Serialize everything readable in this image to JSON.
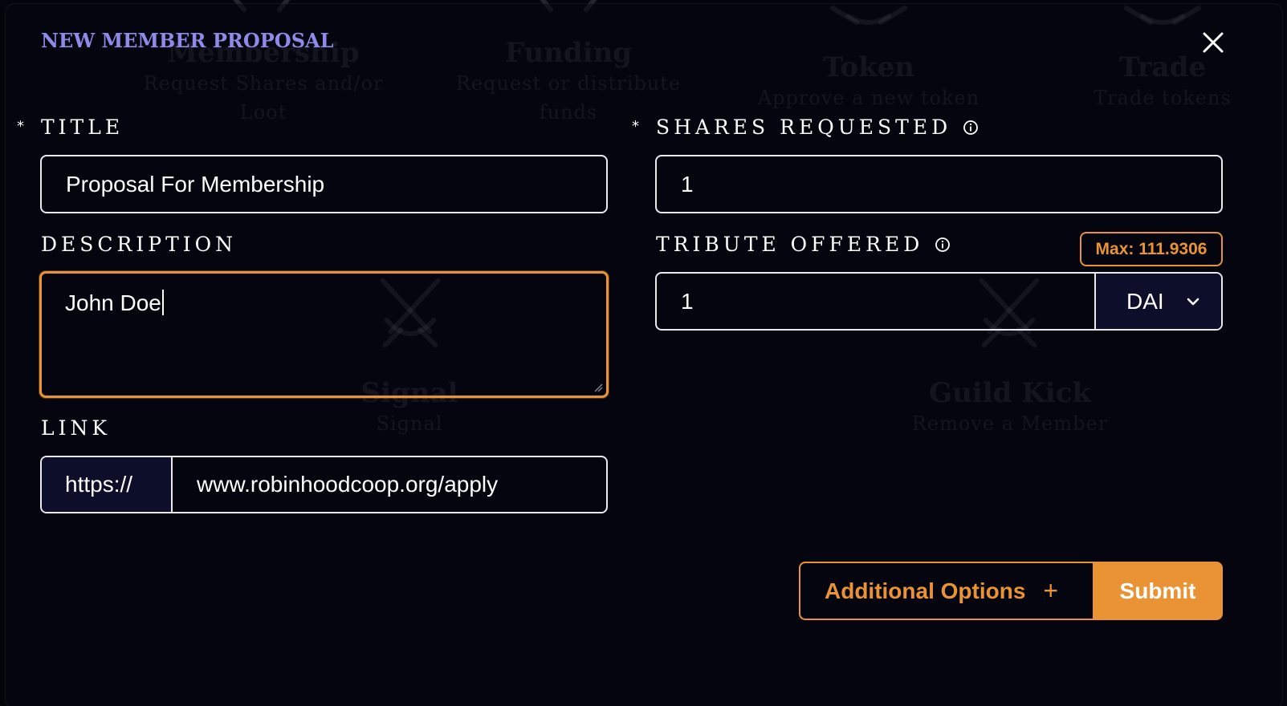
{
  "background": {
    "cards": [
      {
        "title": "Membership",
        "sub1": "Request Shares and/or",
        "sub2": "Loot"
      },
      {
        "title": "Funding",
        "sub1": "Request or distribute",
        "sub2": "funds"
      },
      {
        "title": "Token",
        "sub1": "Approve a new token",
        "sub2": ""
      },
      {
        "title": "Trade",
        "sub1": "Trade tokens",
        "sub2": ""
      },
      {
        "title": "Signal",
        "sub1": "Signal",
        "sub2": ""
      },
      {
        "title": "Guild Kick",
        "sub1": "Remove a Member",
        "sub2": ""
      }
    ]
  },
  "modal": {
    "title": "NEW MEMBER PROPOSAL",
    "close_icon": "close-icon"
  },
  "form": {
    "title": {
      "label": "TITLE",
      "required_mark": "*",
      "value": "Proposal For Membership"
    },
    "description": {
      "label": "DESCRIPTION",
      "value": "John Doe"
    },
    "link": {
      "label": "LINK",
      "prefix": "https://",
      "value": "www.robinhoodcoop.org/apply"
    },
    "shares": {
      "label": "SHARES REQUESTED",
      "required_mark": "*",
      "value": "1",
      "info_icon": "info-icon"
    },
    "tribute": {
      "label": "TRIBUTE OFFERED",
      "value": "1",
      "token": "DAI",
      "max_label": "Max: 111.9306",
      "info_icon": "info-icon"
    }
  },
  "actions": {
    "additional_options": "Additional Options",
    "additional_icon": "+",
    "submit": "Submit"
  },
  "colors": {
    "accent": "#ea9334",
    "title": "#8f89e8",
    "background": "#04040d",
    "select_bg": "#0d0e2a"
  }
}
